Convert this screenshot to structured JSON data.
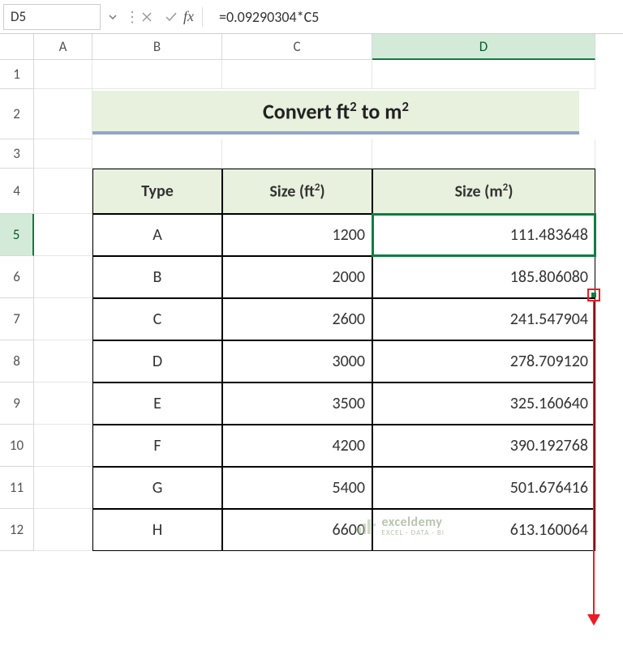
{
  "formula_bar": {
    "cell_ref": "D5",
    "fx_label": "fx",
    "formula": "=0.09290304*C5"
  },
  "columns": [
    "A",
    "B",
    "C",
    "D"
  ],
  "rows": [
    "1",
    "2",
    "3",
    "4",
    "5",
    "6",
    "7",
    "8",
    "9",
    "10",
    "11",
    "12"
  ],
  "title": {
    "pre": "Convert ft",
    "sup1": "2",
    "mid": " to m",
    "sup2": "2"
  },
  "headers": {
    "type": "Type",
    "size_ft_pre": "Size (ft",
    "size_ft_sup": "2",
    "size_ft_post": ")",
    "size_m_pre": "Size (m",
    "size_m_sup": "2",
    "size_m_post": ")"
  },
  "rows_data": [
    {
      "type": "A",
      "ft": "1200",
      "m": "111.483648"
    },
    {
      "type": "B",
      "ft": "2000",
      "m": "185.806080"
    },
    {
      "type": "C",
      "ft": "2600",
      "m": "241.547904"
    },
    {
      "type": "D",
      "ft": "3000",
      "m": "278.709120"
    },
    {
      "type": "E",
      "ft": "3500",
      "m": "325.160640"
    },
    {
      "type": "F",
      "ft": "4200",
      "m": "390.192768"
    },
    {
      "type": "G",
      "ft": "5400",
      "m": "501.676416"
    },
    {
      "type": "H",
      "ft": "6600",
      "m": "613.160064"
    }
  ],
  "watermark": {
    "brand": "exceldemy",
    "sub": "EXCEL · DATA · BI"
  }
}
